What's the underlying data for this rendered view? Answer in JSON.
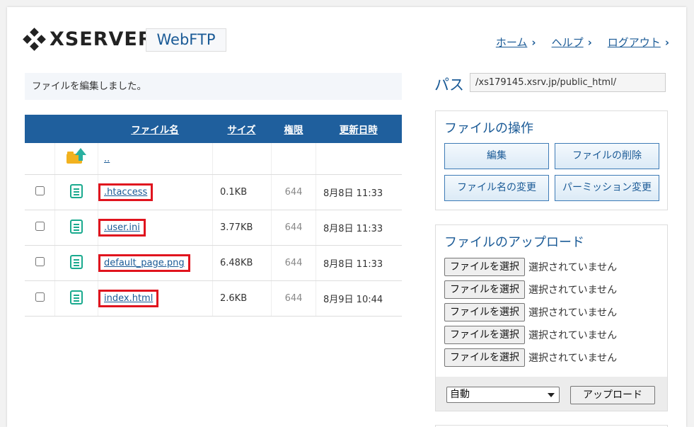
{
  "header": {
    "logo_text": "XSERVER",
    "product": "WebFTP",
    "nav": [
      {
        "label": "ホーム"
      },
      {
        "label": "ヘルプ"
      },
      {
        "label": "ログアウト"
      }
    ]
  },
  "message": "ファイルを編集しました。",
  "table": {
    "headers": {
      "name": "ファイル名",
      "size": "サイズ",
      "perm": "権限",
      "date": "更新日時"
    },
    "parent_link": "..",
    "rows": [
      {
        "name": ".htaccess",
        "size": "0.1KB",
        "perm": "644",
        "date": "8月8日 11:33"
      },
      {
        "name": ".user.ini",
        "size": "3.77KB",
        "perm": "644",
        "date": "8月8日 11:33"
      },
      {
        "name": "default_page.png",
        "size": "6.48KB",
        "perm": "644",
        "date": "8月8日 11:33"
      },
      {
        "name": "index.html",
        "size": "2.6KB",
        "perm": "644",
        "date": "8月9日 10:44"
      }
    ]
  },
  "path": {
    "label": "パス",
    "value": "/xs179145.xsrv.jp/public_html/"
  },
  "file_ops": {
    "title": "ファイルの操作",
    "edit": "編集",
    "delete": "ファイルの削除",
    "rename": "ファイル名の変更",
    "permission": "パーミッション変更"
  },
  "upload": {
    "title": "ファイルのアップロード",
    "choose_label": "ファイルを選択",
    "no_file": "選択されていません",
    "mode_selected": "自動",
    "upload_button": "アップロード"
  },
  "colors": {
    "accent": "#1f5f9d",
    "highlight": "#e0141e",
    "file_icon": "#1aaa8e"
  }
}
